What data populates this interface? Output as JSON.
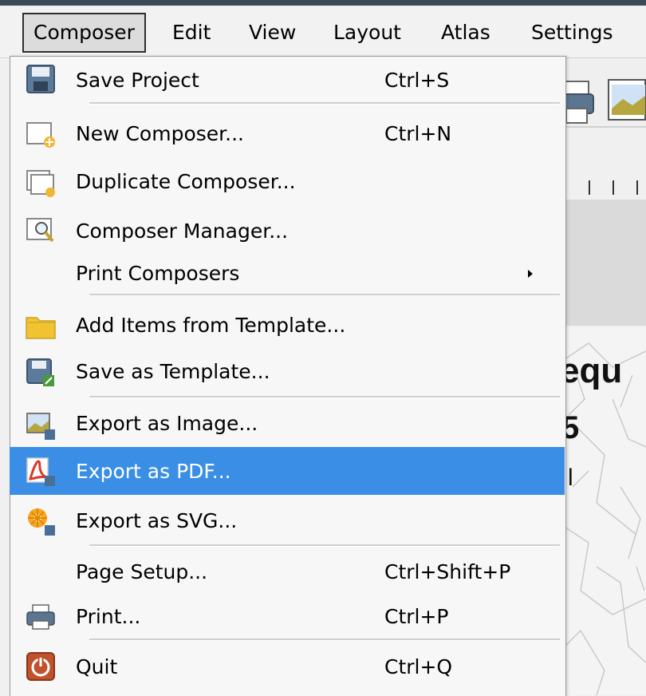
{
  "menubar": {
    "items": [
      "Composer",
      "Edit",
      "View",
      "Layout",
      "Atlas",
      "Settings"
    ]
  },
  "menu": {
    "items": [
      {
        "label": "Save Project",
        "shortcut": "Ctrl+S",
        "icon": "floppy-disk-icon"
      },
      {
        "label": "New Composer...",
        "shortcut": "Ctrl+N",
        "icon": "new-document-icon"
      },
      {
        "label": "Duplicate Composer...",
        "shortcut": "",
        "icon": "duplicate-document-icon"
      },
      {
        "label": "Composer Manager...",
        "shortcut": "",
        "icon": "magnifier-document-icon"
      },
      {
        "label": "Print Composers",
        "shortcut": "",
        "icon": "",
        "submenu": true
      },
      {
        "label": "Add Items from Template...",
        "shortcut": "",
        "icon": "folder-icon"
      },
      {
        "label": "Save as Template...",
        "shortcut": "",
        "icon": "save-template-icon"
      },
      {
        "label": "Export as Image...",
        "shortcut": "",
        "icon": "export-image-icon"
      },
      {
        "label": "Export as PDF...",
        "shortcut": "",
        "icon": "export-pdf-icon",
        "highlighted": true
      },
      {
        "label": "Export as SVG...",
        "shortcut": "",
        "icon": "export-svg-icon"
      },
      {
        "label": "Page Setup...",
        "shortcut": "Ctrl+Shift+P",
        "icon": ""
      },
      {
        "label": "Print...",
        "shortcut": "Ctrl+P",
        "icon": "printer-icon"
      },
      {
        "label": "Quit",
        "shortcut": "Ctrl+Q",
        "icon": "power-icon"
      }
    ]
  },
  "background": {
    "title_fragment": "equ",
    "subtitle_fragment": "5",
    "line_fragment": "l"
  },
  "colors": {
    "highlight": "#3a8ee6",
    "menu_bg": "#f7f7f7"
  }
}
